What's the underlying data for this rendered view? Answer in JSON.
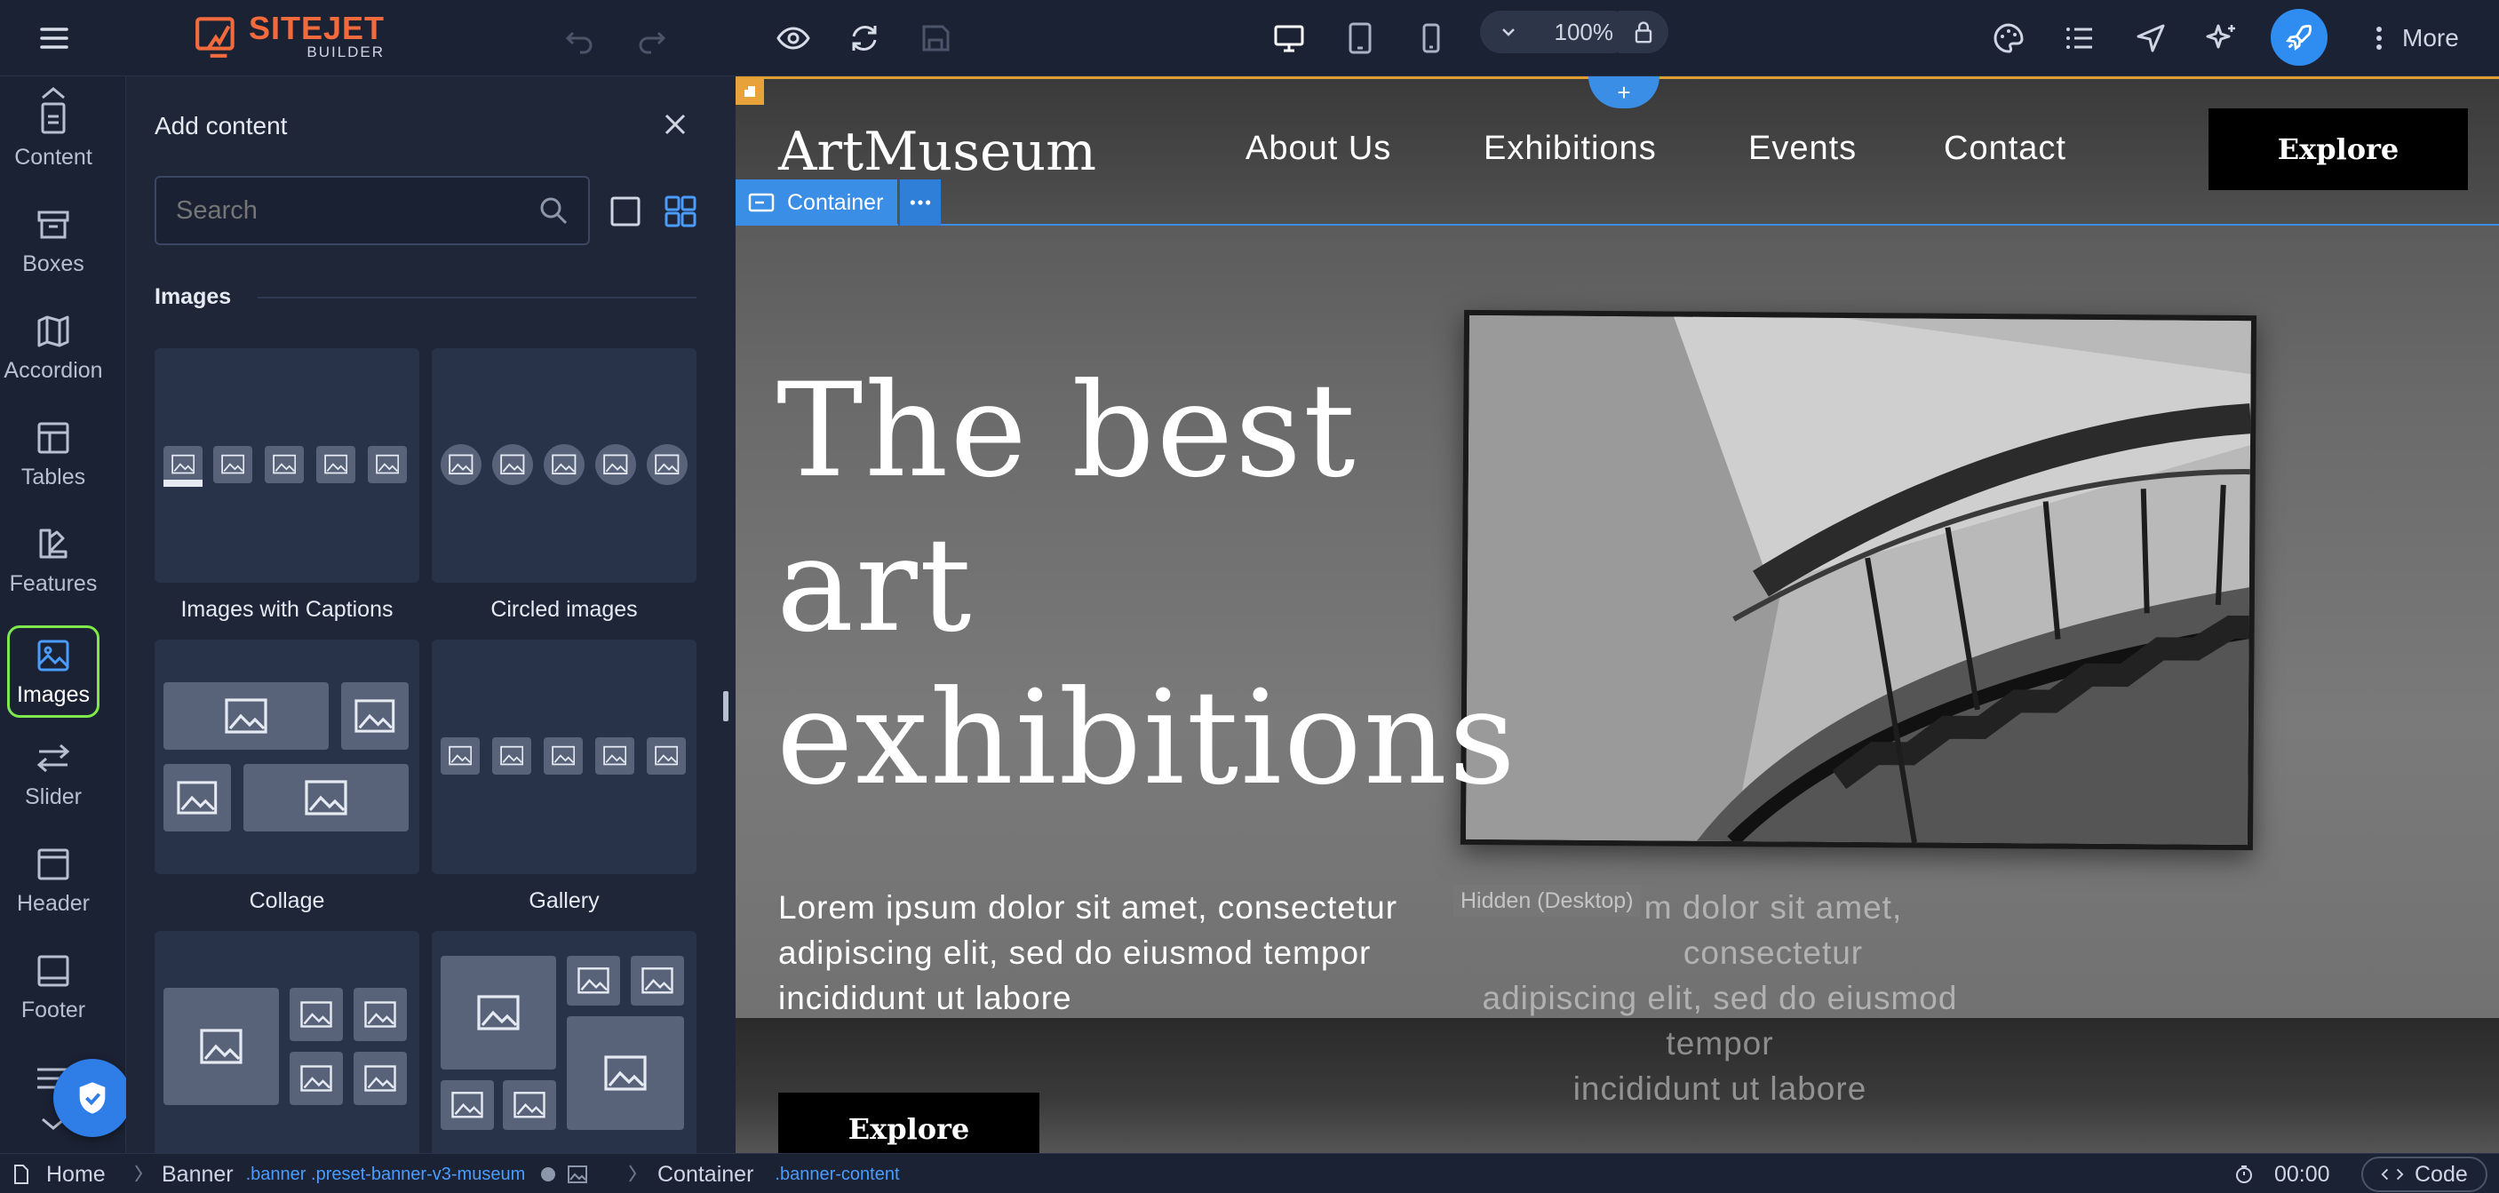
{
  "brand": {
    "name": "SITEJET",
    "sub": "BUILDER"
  },
  "toolbar": {
    "zoom": "100%",
    "more_label": "More"
  },
  "rail": {
    "items": [
      {
        "label": "Content",
        "icon": "content-icon"
      },
      {
        "label": "Boxes",
        "icon": "boxes-icon"
      },
      {
        "label": "Accordion",
        "icon": "accordion-icon"
      },
      {
        "label": "Tables",
        "icon": "tables-icon"
      },
      {
        "label": "Features",
        "icon": "features-icon"
      },
      {
        "label": "Images",
        "icon": "images-icon",
        "active": true
      },
      {
        "label": "Slider",
        "icon": "slider-icon"
      },
      {
        "label": "Header",
        "icon": "header-icon"
      },
      {
        "label": "Footer",
        "icon": "footer-icon"
      }
    ]
  },
  "panel": {
    "title": "Add content",
    "search_placeholder": "Search",
    "section": "Images",
    "tiles": [
      {
        "label": "Images with Captions"
      },
      {
        "label": "Circled images"
      },
      {
        "label": "Collage"
      },
      {
        "label": "Gallery"
      }
    ]
  },
  "site": {
    "logo": "ArtMuseum",
    "nav": [
      "About Us",
      "Exhibitions",
      "Events",
      "Contact"
    ],
    "cta": "Explore",
    "container_label": "Container",
    "headline_lines": [
      "The best",
      "art",
      "exhibitions"
    ],
    "body": "Lorem ipsum dolor sit amet, consectetur adipiscing elit, sed do eiusmod tempor incididunt ut labore",
    "hidden_badge": "Hidden (Desktop)",
    "ghost_body_line1": "m dolor sit amet, consectetur",
    "ghost_body_line2": "adipiscing elit, sed do eiusmod tempor",
    "ghost_body_line3": "incididunt ut labore",
    "hero_button": "Explore"
  },
  "bottombar": {
    "home": "Home",
    "banner": "Banner",
    "banner_class": ".banner .preset-banner-v3-museum",
    "container": "Container",
    "container_class": ".banner-content",
    "timer": "00:00",
    "code": "Code"
  },
  "colors": {
    "accent": "#4a9cff",
    "active_outline": "#7ee84d",
    "brand_orange": "#f36b3c",
    "selection": "#3a8ee6"
  }
}
